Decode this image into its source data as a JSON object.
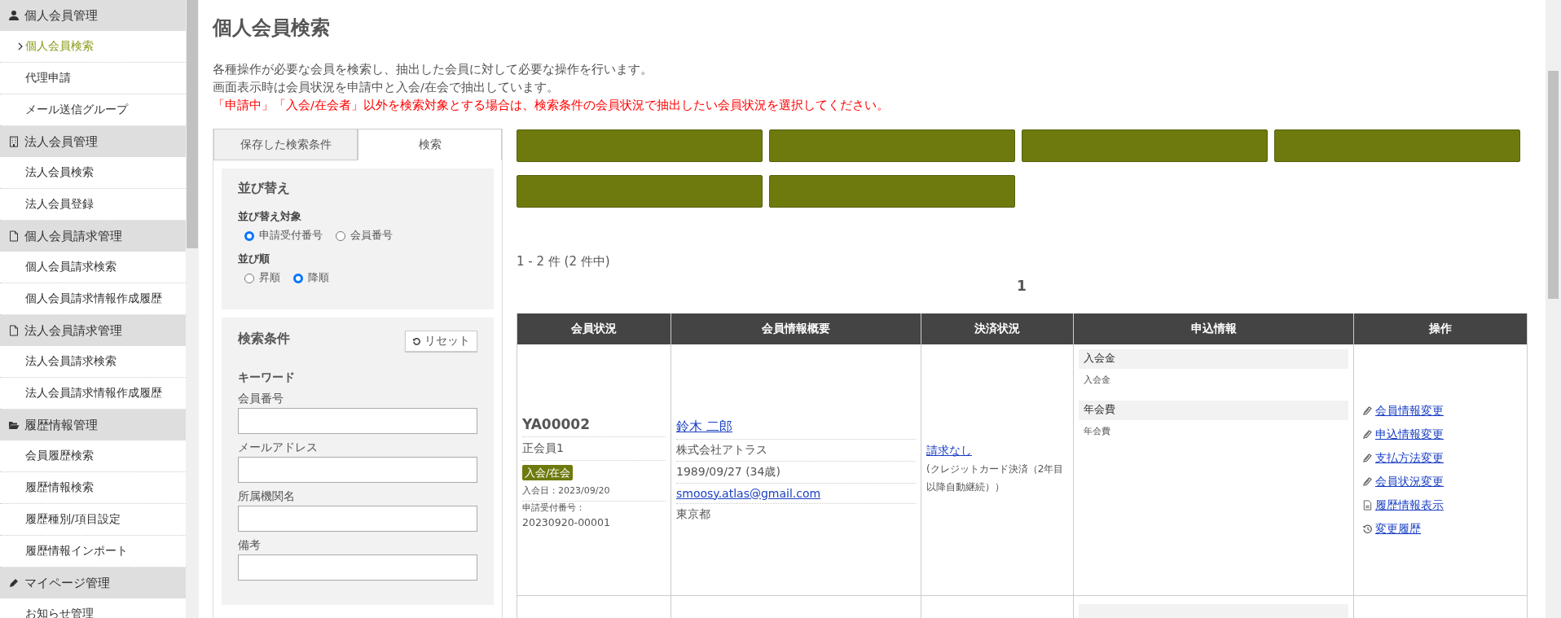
{
  "sidebar": {
    "sections": [
      {
        "title": "個人会員管理",
        "kind": "person",
        "items": [
          {
            "label": "個人会員検索",
            "selected": true
          },
          {
            "label": "代理申請",
            "selected": false
          },
          {
            "label": "メール送信グループ",
            "selected": false
          }
        ]
      },
      {
        "title": "法人会員管理",
        "kind": "building",
        "items": [
          {
            "label": "法人会員検索",
            "selected": false
          },
          {
            "label": "法人会員登録",
            "selected": false
          }
        ]
      },
      {
        "title": "個人会員請求管理",
        "kind": "document",
        "items": [
          {
            "label": "個人会員請求検索",
            "selected": false
          },
          {
            "label": "個人会員請求情報作成履歴",
            "selected": false
          }
        ]
      },
      {
        "title": "法人会員請求管理",
        "kind": "document",
        "items": [
          {
            "label": "法人会員請求検索",
            "selected": false
          },
          {
            "label": "法人会員請求情報作成履歴",
            "selected": false
          }
        ]
      },
      {
        "title": "履歴情報管理",
        "kind": "folder",
        "items": [
          {
            "label": "会員履歴検索",
            "selected": false
          },
          {
            "label": "履歴情報検索",
            "selected": false
          },
          {
            "label": "履歴種別/項目設定",
            "selected": false
          },
          {
            "label": "履歴情報インポート",
            "selected": false
          }
        ]
      },
      {
        "title": "マイページ管理",
        "kind": "pencil",
        "items": [
          {
            "label": "お知らせ管理",
            "selected": false
          }
        ]
      }
    ]
  },
  "page": {
    "title": "個人会員検索",
    "description": [
      "各種操作が必要な会員を検索し、抽出した会員に対して必要な操作を行います。",
      "画面表示時は会員状況を申請中と入会/在会で抽出しています。"
    ],
    "warning": "「申請中」「入会/在会者」以外を検索対象とする場合は、検索条件の会員状況で抽出したい会員状況を選択してください。"
  },
  "search_panel": {
    "tabs": [
      {
        "label": "保存した検索条件",
        "selected": false
      },
      {
        "label": "検索",
        "selected": true
      }
    ],
    "sort": {
      "title": "並び替え",
      "groups": [
        {
          "label": "並び替え対象",
          "options": [
            {
              "label": "申請受付番号",
              "selected": true
            },
            {
              "label": "会員番号",
              "selected": false
            }
          ]
        },
        {
          "label": "並び順",
          "options": [
            {
              "label": "昇順",
              "selected": false
            },
            {
              "label": "降順",
              "selected": true
            }
          ]
        }
      ]
    },
    "conditions": {
      "title": "検索条件",
      "reset_button": "リセット",
      "subheading": "キーワード",
      "fields": [
        {
          "label": "会員番号"
        },
        {
          "label": "メールアドレス"
        },
        {
          "label": "所属機関名"
        },
        {
          "label": "備考"
        }
      ]
    }
  },
  "action_buttons": [
    {
      "kind": "blank"
    },
    {
      "kind": "blank"
    },
    {
      "kind": "blank"
    },
    {
      "kind": "blank"
    },
    {
      "kind": "blank"
    },
    {
      "kind": "blank"
    }
  ],
  "result_count": "1 - 2 件 (2 件中)",
  "pagination": {
    "pages": [
      {
        "label": "1"
      }
    ]
  },
  "table": {
    "columns": [
      "会員状況",
      "会員情報概要",
      "決済状況",
      "申込情報",
      "操作"
    ],
    "rows": [
      {
        "member_id": "YA00002",
        "member_type": "正会員1",
        "status_badge": "入会/在会",
        "join_date": "入会日：2023/09/20",
        "application_label": "申請受付番号：",
        "application_number": "20230920-00001",
        "name": "鈴木 二郎",
        "company": "株式会社アトラス",
        "birthday": "1989/09/27 (34歳)",
        "email": "smoosy.atlas@gmail.com",
        "prefecture": "東京都",
        "payment_status": "請求なし",
        "payment_note": "(クレジットカード決済（2年目以降自動継続））",
        "fees": [
          {
            "heading": "入会金",
            "detail": "入会金"
          },
          {
            "heading": "年会費",
            "detail": "年会費"
          }
        ],
        "operations": [
          {
            "label": "会員情報変更",
            "kind": "edit"
          },
          {
            "label": "申込情報変更",
            "kind": "edit"
          },
          {
            "label": "支払方法変更",
            "kind": "edit"
          },
          {
            "label": "会員状況変更",
            "kind": "edit"
          },
          {
            "label": "履歴情報表示",
            "kind": "document"
          },
          {
            "label": "変更履歴",
            "kind": "history"
          }
        ]
      }
    ]
  }
}
